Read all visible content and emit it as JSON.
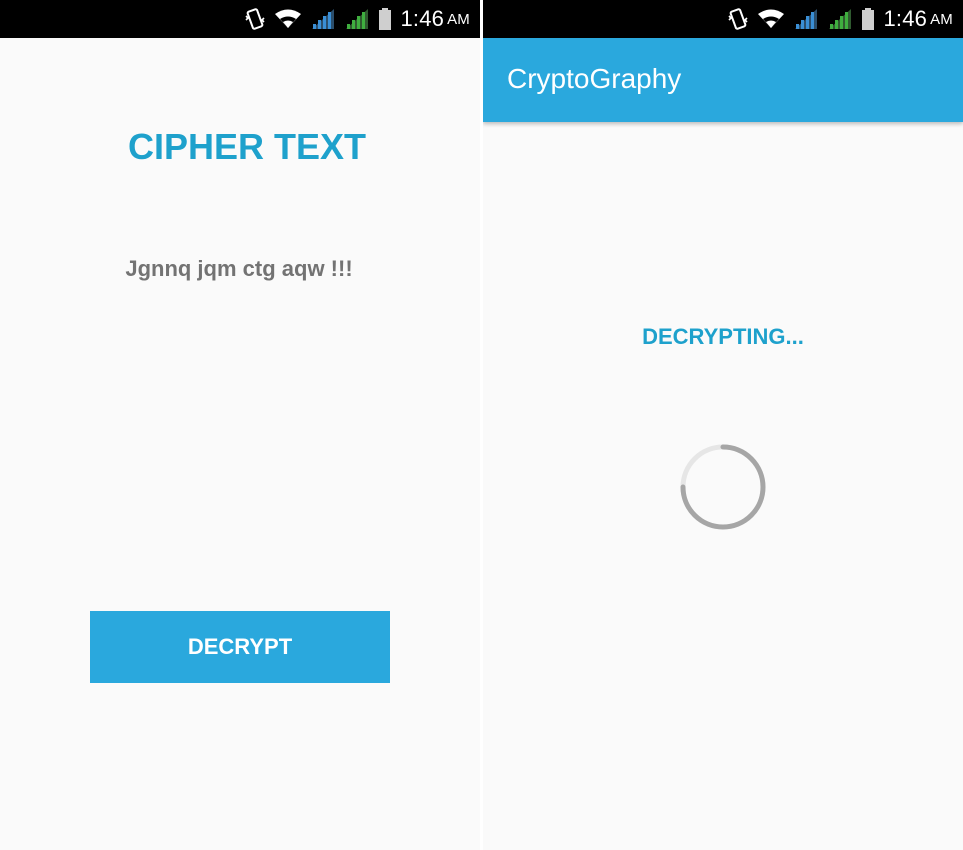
{
  "left_screen": {
    "status_bar": {
      "time": "1:46",
      "ampm": "AM"
    },
    "title": "CIPHER TEXT",
    "cipher_text": "Jgnnq jqm ctg aqw !!!",
    "decrypt_button": "DECRYPT"
  },
  "right_screen": {
    "status_bar": {
      "time": "1:46",
      "ampm": "AM"
    },
    "app_title": "CryptoGraphy",
    "status_text": "DECRYPTING...",
    "progress_indicator": "indeterminate spinner"
  },
  "colors": {
    "accent": "#2aa8dd",
    "title_text": "#1ea1cc",
    "body_text": "#737373",
    "background": "#fafafa",
    "status_bar": "#000000",
    "signal_blue": "#3a8fd6",
    "signal_green": "#3fae3f"
  },
  "icons": [
    "vibrate-icon",
    "wifi-icon",
    "signal-sim1-icon",
    "signal-sim2-icon",
    "battery-icon",
    "progress-spinner-icon"
  ]
}
